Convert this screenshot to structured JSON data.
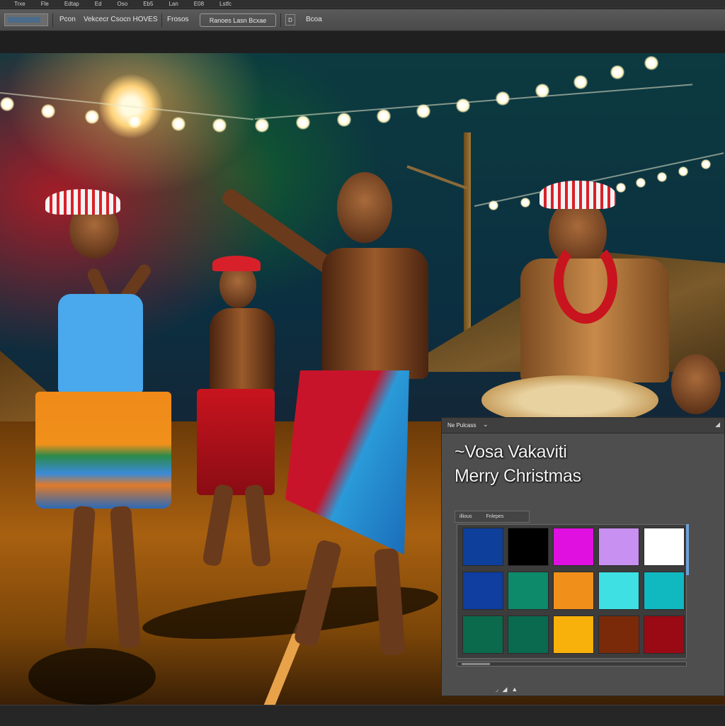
{
  "menubar": {
    "items": [
      "Trxe",
      "Fle",
      "Edtap",
      "Ed",
      "Oso",
      "Eb5",
      "Lan",
      "E08",
      "Lstfc"
    ]
  },
  "options_bar": {
    "labels": [
      "Pcon",
      "Vekcecr Csocn HOVES",
      "Frosos"
    ],
    "box_label": "Ranoes Lasn Bcxae",
    "icon_glyph": "D",
    "last_label": "Bcoa"
  },
  "panel": {
    "title": "Ne Pulcass",
    "chevron": "⌄",
    "close_glyph": "◢",
    "text_lines": [
      "~Vosa Vakaviti",
      "Merry Christmas"
    ],
    "swatch_tabs": [
      "illious",
      "Fnlepes"
    ],
    "swatch_colors": [
      [
        "#0e3f9a",
        "#000000",
        "#e010e0",
        "#c890f0",
        "#ffffff"
      ],
      [
        "#0f3da0",
        "#0c8a6a",
        "#f0901a",
        "#3ee0e4",
        "#10b8c0"
      ],
      [
        "#0b6a4c",
        "#0a6a50",
        "#f8b00a",
        "#7a2a08",
        "#9a0a14"
      ]
    ],
    "footer_glyphs": "◞◢▲"
  }
}
